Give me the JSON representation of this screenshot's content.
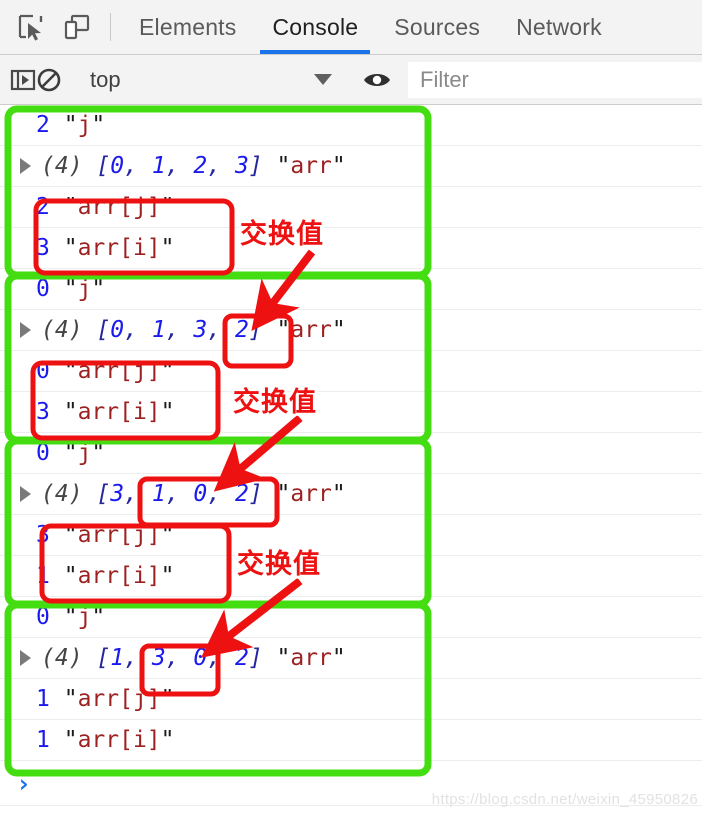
{
  "tabbar": {
    "icons": [
      {
        "name": "inspect-element-icon",
        "label": "Inspect element"
      },
      {
        "name": "device-toolbar-icon",
        "label": "Toggle device toolbar"
      }
    ],
    "tabs": [
      {
        "label": "Elements",
        "active": false
      },
      {
        "label": "Console",
        "active": true
      },
      {
        "label": "Sources",
        "active": false
      },
      {
        "label": "Network",
        "active": false
      }
    ],
    "active_tab": "Console",
    "active_underline_color": "#1a73e8"
  },
  "toolbar": {
    "sidebar_toggle_label": "Show console sidebar",
    "clear_console_label": "Clear console",
    "context_selected": "top",
    "context_caret": "▼",
    "eye_label": "Create live expression",
    "filter_placeholder": "Filter",
    "filter_value": ""
  },
  "console": {
    "groups": [
      {
        "id": "group-1",
        "rows": [
          {
            "type": "value",
            "num": "2",
            "label": "j",
            "boxed": false
          },
          {
            "type": "array",
            "count": "(4)",
            "items": [
              "0",
              "1",
              "2",
              "3"
            ],
            "label": "arr",
            "highlight": null
          },
          {
            "type": "value",
            "num": "2",
            "label": "arr[j]",
            "boxed": true
          },
          {
            "type": "value",
            "num": "3",
            "label": "arr[i]",
            "boxed": true
          }
        ],
        "annotation": {
          "text": "交换值",
          "target": "next-group-array"
        }
      },
      {
        "id": "group-2",
        "rows": [
          {
            "type": "value",
            "num": "0",
            "label": "j",
            "boxed": false
          },
          {
            "type": "array",
            "count": "(4)",
            "items": [
              "0",
              "1",
              "3",
              "2"
            ],
            "label": "arr",
            "highlight": {
              "from": 2,
              "to": 3
            }
          },
          {
            "type": "value",
            "num": "0",
            "label": "arr[j]",
            "boxed": true
          },
          {
            "type": "value",
            "num": "3",
            "label": "arr[i]",
            "boxed": true
          }
        ],
        "annotation": {
          "text": "交换值",
          "target": "next-group-array"
        }
      },
      {
        "id": "group-3",
        "rows": [
          {
            "type": "value",
            "num": "0",
            "label": "j",
            "boxed": false
          },
          {
            "type": "array",
            "count": "(4)",
            "items": [
              "3",
              "1",
              "0",
              "2"
            ],
            "label": "arr",
            "highlight": {
              "from": 0,
              "to": 2
            }
          },
          {
            "type": "value",
            "num": "3",
            "label": "arr[j]",
            "boxed": true
          },
          {
            "type": "value",
            "num": "1",
            "label": "arr[i]",
            "boxed": true
          }
        ],
        "annotation": {
          "text": "交换值",
          "target": "next-group-array"
        }
      },
      {
        "id": "group-4",
        "rows": [
          {
            "type": "value",
            "num": "0",
            "label": "j",
            "boxed": false
          },
          {
            "type": "array",
            "count": "(4)",
            "items": [
              "1",
              "3",
              "0",
              "2"
            ],
            "label": "arr",
            "highlight": {
              "from": 0,
              "to": 1
            }
          },
          {
            "type": "value",
            "num": "1",
            "label": "arr[j]",
            "boxed": false
          },
          {
            "type": "value",
            "num": "1",
            "label": "arr[i]",
            "boxed": false
          }
        ],
        "annotation": null
      }
    ],
    "prompt_caret": "›"
  },
  "annotations": {
    "swap_label": "交换值",
    "label_color": "#ee1111",
    "group_box_color": "#44dd11",
    "highlight_box_color": "#ee1111"
  },
  "watermark": {
    "text": "https://blog.csdn.net/weixin_45950826"
  }
}
